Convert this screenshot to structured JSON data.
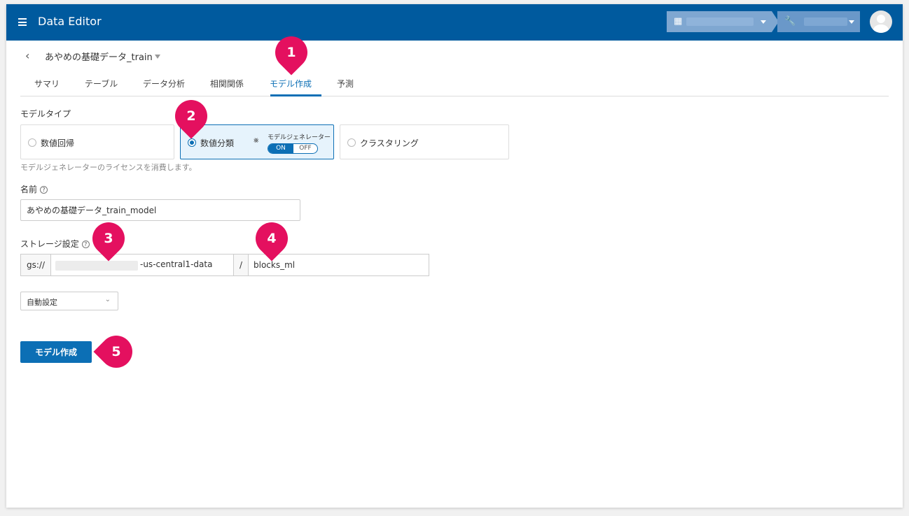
{
  "app": {
    "title": "Data Editor"
  },
  "header": {
    "org_icon": "building-icon",
    "project_icon": "wrench-icon"
  },
  "dataset": {
    "title": "あやめの基礎データ_train"
  },
  "tabs": [
    {
      "label": "サマリ"
    },
    {
      "label": "テーブル"
    },
    {
      "label": "データ分析"
    },
    {
      "label": "相関関係"
    },
    {
      "label": "モデル作成",
      "active": true
    },
    {
      "label": "予測"
    }
  ],
  "model_type": {
    "label": "モデルタイプ",
    "options": [
      {
        "label": "数値回帰",
        "selected": false
      },
      {
        "label": "数値分類",
        "selected": true
      },
      {
        "label": "クラスタリング",
        "selected": false
      }
    ],
    "model_generator": {
      "label": "モデルジェネレーター",
      "on_label": "ON",
      "off_label": "OFF",
      "value": "ON"
    },
    "help": "モデルジェネレーターのライセンスを消費します。"
  },
  "name": {
    "label": "名前",
    "value": "あやめの基礎データ_train_model"
  },
  "storage": {
    "label": "ストレージ設定",
    "prefix": "gs://",
    "bucket_suffix": "-us-central1-data",
    "separator": "/",
    "path": "blocks_ml"
  },
  "region_select": {
    "value": "自動設定"
  },
  "create_button": {
    "label": "モデル作成"
  },
  "markers": [
    "1",
    "2",
    "3",
    "4",
    "5"
  ],
  "colors": {
    "header": "#005a9e",
    "accent": "#0c6fb5",
    "marker": "#e4105f"
  }
}
